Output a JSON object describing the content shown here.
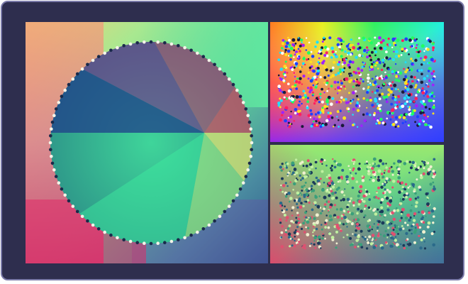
{
  "gallery": {
    "panels": [
      {
        "id": "domain-coloring-circle",
        "description_icon": "circle-zeros-plot"
      },
      {
        "id": "domain-coloring-rainbow-field",
        "description_icon": "rainbow-zeros-plot"
      },
      {
        "id": "domain-coloring-green-field",
        "description_icon": "green-zeros-plot"
      }
    ]
  },
  "colors": {
    "frame_bg": "#2e2e4e",
    "frame_border": "#7a7aa8"
  }
}
